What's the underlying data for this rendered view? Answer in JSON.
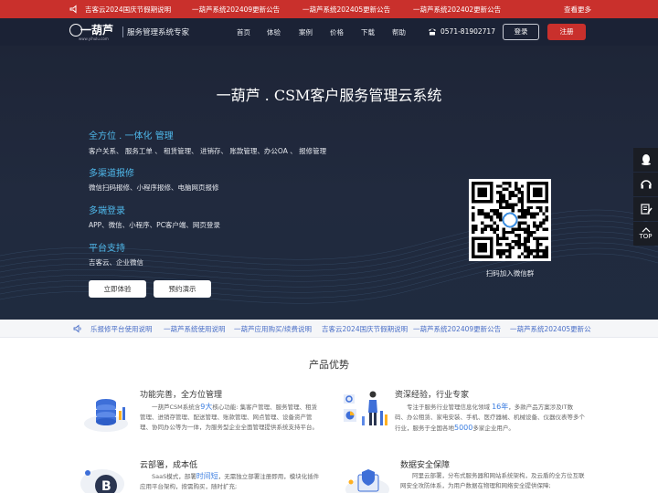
{
  "announcements": {
    "items": [
      "吉客云2024国庆节假期说明",
      "一葫芦系统202409更新公告",
      "一葫芦系统202405更新公告",
      "一葫芦系统202402更新公告"
    ],
    "more": "查看更多"
  },
  "header": {
    "logo_text": "一葫芦",
    "logo_url": "www.yihulu.com",
    "tagline": "服务管理系统专家",
    "nav": [
      "首页",
      "体验",
      "案例",
      "价格",
      "下载",
      "帮助"
    ],
    "phone": "0571-81902717",
    "login": "登录",
    "register": "注册"
  },
  "hero": {
    "title": "一葫芦 . CSM客户服务管理云系统",
    "features": [
      {
        "heading": "全方位 . 一体化 管理",
        "text": "客户关系、 服务工单 、 租赁管理、 进销存、 账款管理、办公OA 、 报修管理"
      },
      {
        "heading": "多渠道报修",
        "text": "微信扫码报修、小程序报修、电脑网页报修"
      },
      {
        "heading": "多端登录",
        "text": "APP、微信、小程序、PC客户端、网页登录"
      },
      {
        "heading": "平台支持",
        "text": "吉客云、企业微信"
      }
    ],
    "btn_trial": "立即体验",
    "btn_demo": "预约演示",
    "qr_caption": "扫码加入微信群"
  },
  "side": {
    "top_label": "TOP"
  },
  "ticker": {
    "items": [
      "乐报修平台使用说明",
      "一葫芦系统使用说明",
      "一葫芦应用购买/续费说明",
      "吉客云2024国庆节假期说明",
      "一葫芦系统202409更新公告",
      "一葫芦系统202405更新公"
    ]
  },
  "advantages": {
    "title": "产品优势",
    "items": [
      {
        "heading": "功能完善，全方位管理",
        "text_parts": [
          "一葫芦CSM系统含",
          "9大",
          "核心功能: 集客户管理、服务管理、租赁管理、进销存管理、配送管理、账款管理、网点管理、设备资产管理、协同办公等为一体，为服务型企业全面管理提供系统支持平台。"
        ]
      },
      {
        "heading": "资深经验，行业专家",
        "text_parts": [
          "专注于服务行业管理信息化领域 ",
          "16年",
          "，多款产品方案涉及IT数码、办公租赁、家电安装、手机、医疗器械、机械设备、仪器仪表等多个行业，服务于全国各地",
          "5000",
          "多家企业用户。"
        ]
      },
      {
        "heading": "云部署，成本低",
        "text_parts": [
          "SaaS模式，部署",
          "时间短",
          "，无需独立部署注册即用，模块化插件应用平台架构，按需购买，随时扩充;"
        ]
      },
      {
        "heading": "数据安全保障",
        "text_parts": [
          "阿里云部署，分布式服务器和网站系统架构，及云盾的全方位互联网安全攻防体系，为用户数据在物理和网络安全提供保障;"
        ]
      }
    ]
  },
  "colors": {
    "accent_red": "#c9302c",
    "header_bg": "#1b2235",
    "hero_heading": "#4fb8ea",
    "link_blue": "#4a6fc7"
  }
}
